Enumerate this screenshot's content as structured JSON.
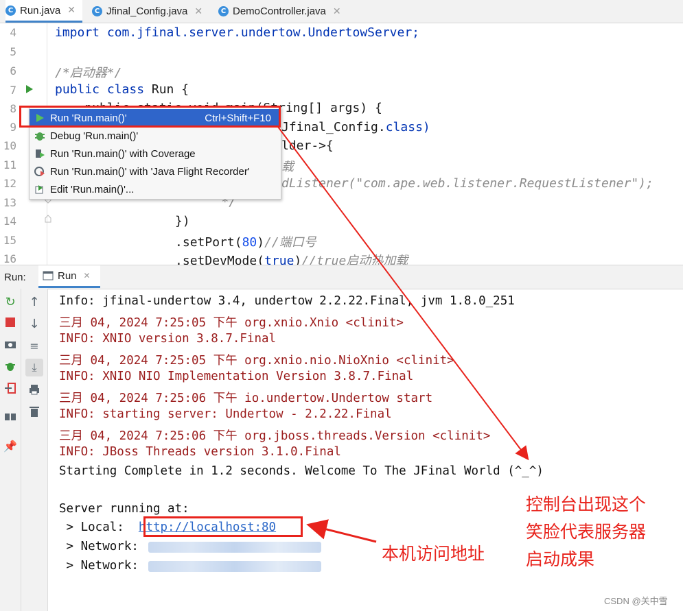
{
  "tabs": [
    {
      "label": "Run.java",
      "icon": "java-run-file-icon"
    },
    {
      "label": "Jfinal_Config.java",
      "icon": "java-class-icon"
    },
    {
      "label": "DemoController.java",
      "icon": "java-class-icon"
    }
  ],
  "editor": {
    "line_numbers": [
      "4",
      "5",
      "6",
      "7",
      "8",
      "9",
      "10",
      "11",
      "12",
      "13",
      "14",
      "15",
      "16"
    ],
    "lines": {
      "l4": "import com.jfinal.server.undertow.UndertowServer;",
      "l6": "/*启动器*/",
      "l7a": "public class",
      "l7b": " Run {",
      "l8": "    public static void main(String[] args) {",
      "l9": "Jfinal_Config.",
      "l9b": "class)",
      "l10": "lder->{",
      "l11": "载",
      "l12": "dListener(\"com.ape.web.listener.RequestListener\");",
      "l13": "          */",
      "l14": "      })",
      "l15a": "      .setPort(",
      "l15n": "80",
      "l15b": ")",
      "l15c": "//端口号",
      "l16a": "      .setDevMode(",
      "l16n": "true",
      "l16b": ")",
      "l16c": "//true启动热加载"
    }
  },
  "context_menu": {
    "items": [
      {
        "label": "Run 'Run.main()'",
        "shortcut": "Ctrl+Shift+F10",
        "icon": "run-icon",
        "selected": true
      },
      {
        "label": "Debug 'Run.main()'",
        "shortcut": "",
        "icon": "debug-icon",
        "selected": false
      },
      {
        "label": "Run 'Run.main()' with Coverage",
        "shortcut": "",
        "icon": "coverage-icon",
        "selected": false
      },
      {
        "label": "Run 'Run.main()' with 'Java Flight Recorder'",
        "shortcut": "",
        "icon": "flight-recorder-icon",
        "selected": false
      },
      {
        "label": "Edit 'Run.main()'...",
        "shortcut": "",
        "icon": "edit-config-icon",
        "selected": false
      }
    ]
  },
  "run_panel": {
    "title": "Run:",
    "tab_label": "Run",
    "console_lines": [
      {
        "text": "Info: jfinal-undertow 3.4, undertow 2.2.22.Final, jvm 1.8.0_251",
        "style": "blk"
      },
      {
        "text": "三月 04, 2024 7:25:05 下午 org.xnio.Xnio <clinit>",
        "style": "red"
      },
      {
        "text": "INFO: XNIO version 3.8.7.Final",
        "style": "red"
      },
      {
        "text": "三月 04, 2024 7:25:05 下午 org.xnio.nio.NioXnio <clinit>",
        "style": "red"
      },
      {
        "text": "INFO: XNIO NIO Implementation Version 3.8.7.Final",
        "style": "red"
      },
      {
        "text": "三月 04, 2024 7:25:06 下午 io.undertow.Undertow start",
        "style": "red"
      },
      {
        "text": "INFO: starting server: Undertow - 2.2.22.Final",
        "style": "red"
      },
      {
        "text": "三月 04, 2024 7:25:06 下午 org.jboss.threads.Version <clinit>",
        "style": "red"
      },
      {
        "text": "INFO: JBoss Threads version 3.1.0.Final",
        "style": "red"
      },
      {
        "text": "Starting Complete in 1.2 seconds. Welcome To The JFinal World (^_^)",
        "style": "blk"
      },
      {
        "text": "",
        "style": "blk"
      },
      {
        "text": "Server running at:",
        "style": "blk"
      }
    ],
    "local_label": " > Local:  ",
    "local_url": "http://localhost:80",
    "network_label": " > Network: "
  },
  "annotations": {
    "smile_note": [
      "控制台出现这个",
      "笑脸代表服务器",
      "启动成果"
    ],
    "local_note": "本机访问地址"
  },
  "watermark": "CSDN @关中雪",
  "colors": {
    "annotation_red": "#e8231c",
    "selection_blue": "#2f65ca",
    "log_red": "#9b1c1c",
    "link_blue": "#2a67c8"
  }
}
